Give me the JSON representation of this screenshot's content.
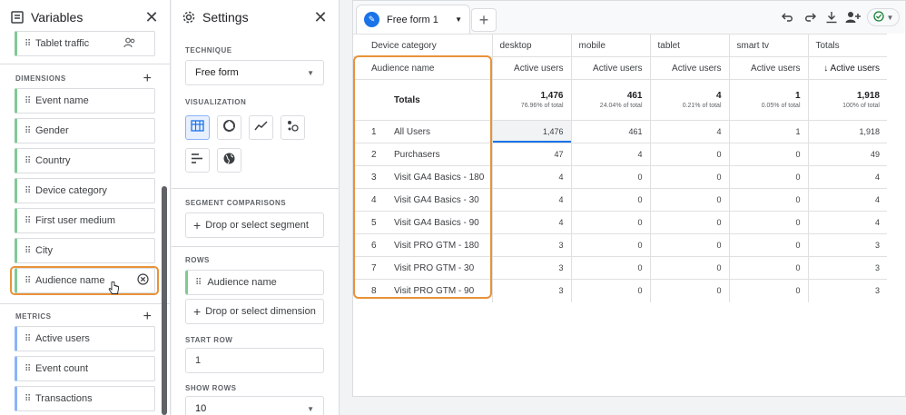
{
  "variables": {
    "title": "Variables",
    "top_item": "Tablet traffic",
    "dimensions_label": "DIMENSIONS",
    "dimensions": [
      "Event name",
      "Gender",
      "Country",
      "Device category",
      "First user medium",
      "City",
      "Audience name"
    ],
    "metrics_label": "METRICS",
    "metrics": [
      "Active users",
      "Event count",
      "Transactions"
    ]
  },
  "settings": {
    "title": "Settings",
    "technique_label": "TECHNIQUE",
    "technique_value": "Free form",
    "visualization_label": "VISUALIZATION",
    "segment_label": "SEGMENT COMPARISONS",
    "segment_drop": "Drop or select segment",
    "rows_label": "ROWS",
    "rows_item": "Audience name",
    "rows_drop": "Drop or select dimension",
    "start_row_label": "START ROW",
    "start_row_value": "1",
    "show_rows_label": "SHOW ROWS",
    "show_rows_value": "10"
  },
  "canvas": {
    "tab_name": "Free form 1",
    "header": {
      "dim_label": "Device category",
      "columns": [
        "desktop",
        "mobile",
        "tablet",
        "smart tv",
        "Totals"
      ]
    },
    "metric_row": {
      "dim_label": "Audience name",
      "columns": [
        "Active users",
        "Active users",
        "Active users",
        "Active users",
        "↓ Active users"
      ]
    },
    "totals": {
      "label": "Totals",
      "values": [
        "1,476",
        "461",
        "4",
        "1",
        "1,918"
      ],
      "subs": [
        "76.96% of total",
        "24.04% of total",
        "0.21% of total",
        "0.05% of total",
        "100% of total"
      ]
    },
    "rows": [
      {
        "idx": "1",
        "name": "All Users",
        "values": [
          "1,476",
          "461",
          "4",
          "1",
          "1,918"
        ]
      },
      {
        "idx": "2",
        "name": "Purchasers",
        "values": [
          "47",
          "4",
          "0",
          "0",
          "49"
        ]
      },
      {
        "idx": "3",
        "name": "Visit GA4 Basics - 180",
        "values": [
          "4",
          "0",
          "0",
          "0",
          "4"
        ]
      },
      {
        "idx": "4",
        "name": "Visit GA4 Basics - 30",
        "values": [
          "4",
          "0",
          "0",
          "0",
          "4"
        ]
      },
      {
        "idx": "5",
        "name": "Visit GA4 Basics - 90",
        "values": [
          "4",
          "0",
          "0",
          "0",
          "4"
        ]
      },
      {
        "idx": "6",
        "name": "Visit PRO GTM - 180",
        "values": [
          "3",
          "0",
          "0",
          "0",
          "3"
        ]
      },
      {
        "idx": "7",
        "name": "Visit PRO GTM - 30",
        "values": [
          "3",
          "0",
          "0",
          "0",
          "3"
        ]
      },
      {
        "idx": "8",
        "name": "Visit PRO GTM - 90",
        "values": [
          "3",
          "0",
          "0",
          "0",
          "3"
        ]
      }
    ]
  },
  "colors": {
    "accent": "#1a73e8",
    "highlight": "#e8923a",
    "dimension": "#81c995",
    "metric": "#8ab4f8"
  }
}
